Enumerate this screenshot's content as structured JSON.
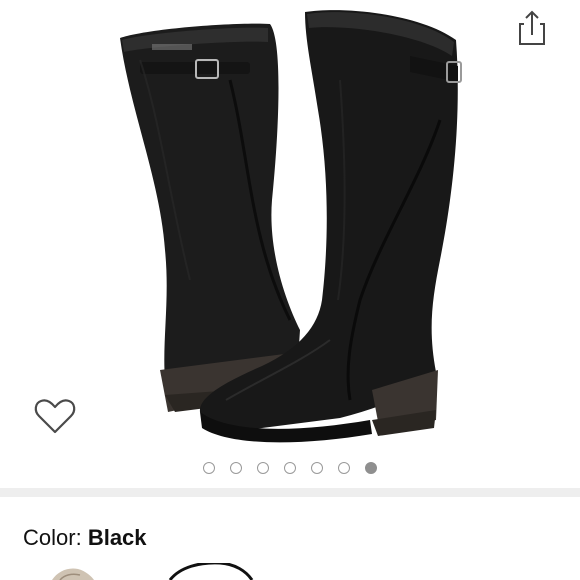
{
  "icons": {
    "share": "share-icon",
    "wishlist": "heart-icon"
  },
  "gallery": {
    "image_count": 7,
    "active_index": 6
  },
  "color_selector": {
    "label": "Color:",
    "value": "Black"
  },
  "colors": {
    "dot_active": "#8f8f8f",
    "dot_inactive_border": "#9a9a9a",
    "divider": "#eeeeee",
    "text": "#111111"
  }
}
